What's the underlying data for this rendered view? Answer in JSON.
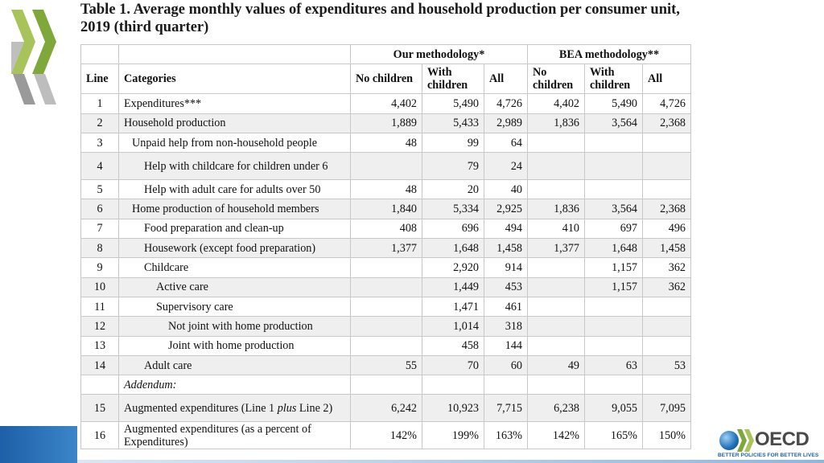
{
  "title": {
    "label": "Table 1.",
    "text": " Average monthly values of expenditures and household production per consumer unit, 2019 (third quarter)"
  },
  "header": {
    "line": "Line",
    "categories": "Categories",
    "group_ours": "Our methodology*",
    "group_bea": "BEA methodology**",
    "no_children": "No children",
    "with_children": "With children",
    "all": "All"
  },
  "rows": [
    {
      "line": "1",
      "category": "Expenditures***",
      "o_nc": "4,402",
      "o_wc": "5,490",
      "o_all": "4,726",
      "b_nc": "4,402",
      "b_wc": "5,490",
      "b_all": "4,726"
    },
    {
      "line": "2",
      "category": "Household production",
      "o_nc": "1,889",
      "o_wc": "5,433",
      "o_all": "2,989",
      "b_nc": "1,836",
      "b_wc": "3,564",
      "b_all": "2,368"
    },
    {
      "line": "3",
      "category": "Unpaid help from non-household people",
      "o_nc": "48",
      "o_wc": "99",
      "o_all": "64",
      "b_nc": "",
      "b_wc": "",
      "b_all": ""
    },
    {
      "line": "4",
      "category": "Help with childcare for children under 6",
      "o_nc": "",
      "o_wc": "79",
      "o_all": "24",
      "b_nc": "",
      "b_wc": "",
      "b_all": ""
    },
    {
      "line": "5",
      "category": "Help with adult care for adults over 50",
      "o_nc": "48",
      "o_wc": "20",
      "o_all": "40",
      "b_nc": "",
      "b_wc": "",
      "b_all": ""
    },
    {
      "line": "6",
      "category": "Home production of household members",
      "o_nc": "1,840",
      "o_wc": "5,334",
      "o_all": "2,925",
      "b_nc": "1,836",
      "b_wc": "3,564",
      "b_all": "2,368"
    },
    {
      "line": "7",
      "category": "Food preparation and clean-up",
      "o_nc": "408",
      "o_wc": "696",
      "o_all": "494",
      "b_nc": "410",
      "b_wc": "697",
      "b_all": "496"
    },
    {
      "line": "8",
      "category": "Housework (except food preparation)",
      "o_nc": "1,377",
      "o_wc": "1,648",
      "o_all": "1,458",
      "b_nc": "1,377",
      "b_wc": "1,648",
      "b_all": "1,458"
    },
    {
      "line": "9",
      "category": "Childcare",
      "o_nc": "",
      "o_wc": "2,920",
      "o_all": "914",
      "b_nc": "",
      "b_wc": "1,157",
      "b_all": "362"
    },
    {
      "line": "10",
      "category": "Active care",
      "o_nc": "",
      "o_wc": "1,449",
      "o_all": "453",
      "b_nc": "",
      "b_wc": "1,157",
      "b_all": "362"
    },
    {
      "line": "11",
      "category": "Supervisory care",
      "o_nc": "",
      "o_wc": "1,471",
      "o_all": "461",
      "b_nc": "",
      "b_wc": "",
      "b_all": ""
    },
    {
      "line": "12",
      "category": "Not joint with home production",
      "o_nc": "",
      "o_wc": "1,014",
      "o_all": "318",
      "b_nc": "",
      "b_wc": "",
      "b_all": ""
    },
    {
      "line": "13",
      "category": "Joint with home production",
      "o_nc": "",
      "o_wc": "458",
      "o_all": "144",
      "b_nc": "",
      "b_wc": "",
      "b_all": ""
    },
    {
      "line": "14",
      "category": "Adult care",
      "o_nc": "55",
      "o_wc": "70",
      "o_all": "60",
      "b_nc": "49",
      "b_wc": "63",
      "b_all": "53"
    }
  ],
  "addendum": "Addendum:",
  "row15": {
    "line": "15",
    "category_a": "Augmented expenditures (Line 1 ",
    "category_plus": "plus",
    "category_b": " Line 2)",
    "o_nc": "6,242",
    "o_wc": "10,923",
    "o_all": "7,715",
    "b_nc": "6,238",
    "b_wc": "9,055",
    "b_all": "7,095"
  },
  "row16": {
    "line": "16",
    "category": "Augmented expenditures (as a percent of Expenditures)",
    "o_nc": "142%",
    "o_wc": "199%",
    "o_all": "163%",
    "b_nc": "142%",
    "b_wc": "165%",
    "b_all": "150%"
  },
  "logo": {
    "text": "OECD",
    "tagline": "BETTER POLICIES FOR BETTER LIVES"
  },
  "colors": {
    "accent": "#1d5fa8",
    "chevron": "#7fa83a",
    "row_alt": "#efefef"
  }
}
